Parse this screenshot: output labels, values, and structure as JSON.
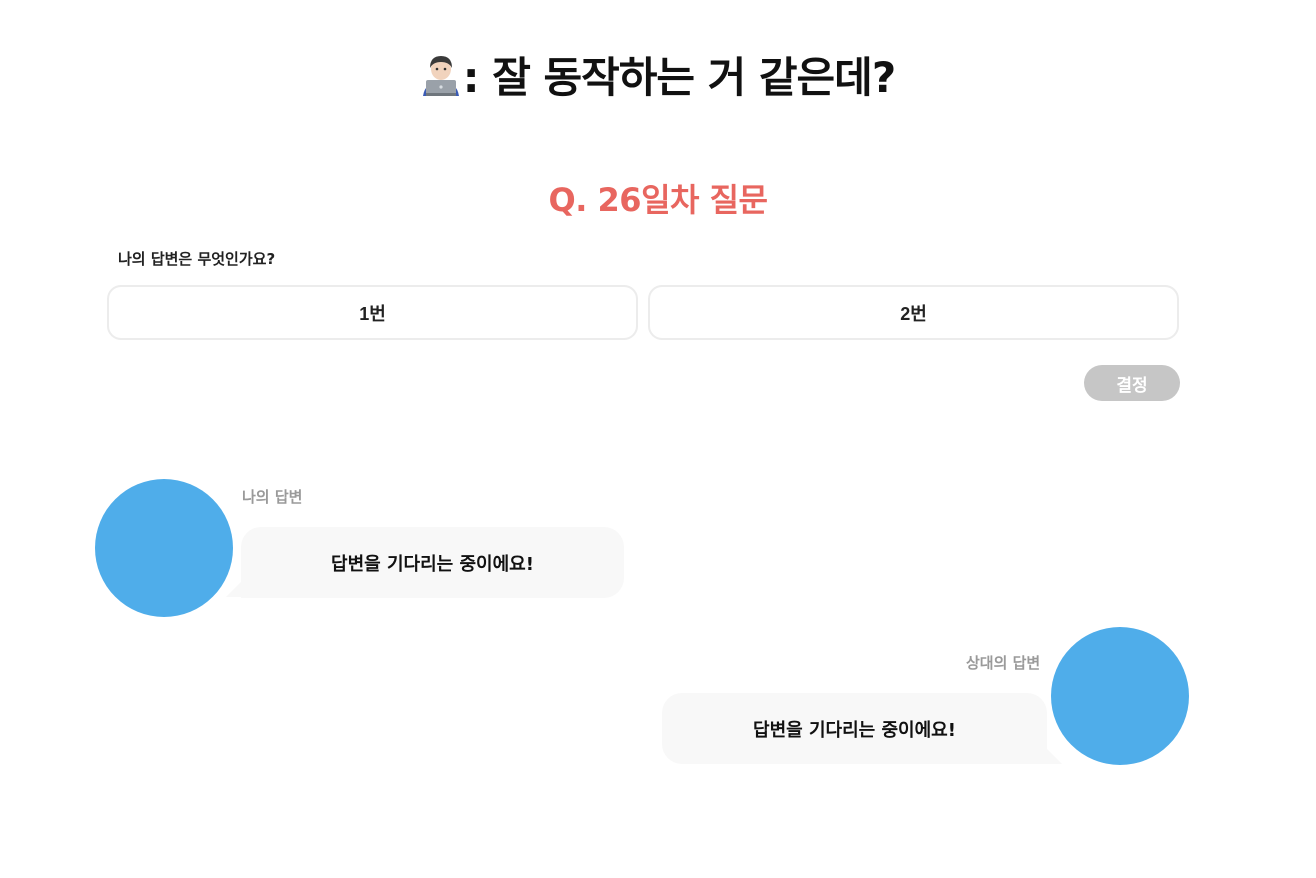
{
  "header": {
    "emoji_icon": "technologist-icon",
    "title": ": 잘 동작하는 거 같은데?"
  },
  "question": {
    "title": "Q. 26일차 질문",
    "label": "나의 답변은 무엇인가요?"
  },
  "choices": [
    {
      "label": "1번"
    },
    {
      "label": "2번"
    }
  ],
  "decide_button": {
    "label": "결정",
    "enabled": false
  },
  "answers": {
    "mine": {
      "name": "나의 답변",
      "text": "답변을 기다리는 중이에요!"
    },
    "opponent": {
      "name": "상대의 답변",
      "text": "답변을 기다리는 중이에요!"
    }
  },
  "colors": {
    "accent": "#e8665f",
    "avatar": "#4fadea",
    "button_disabled": "#c6c6c6",
    "bubble_bg": "#f8f8f8",
    "muted_text": "#9a9a9a"
  }
}
